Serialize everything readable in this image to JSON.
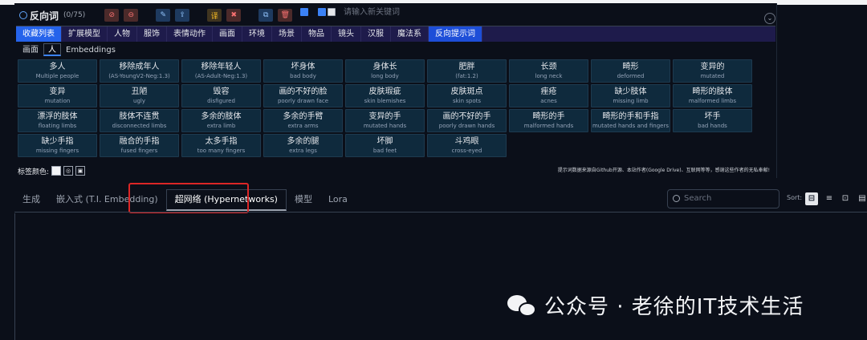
{
  "negative": {
    "title": "反向词",
    "count": "(0/75)",
    "keyword_placeholder": "请输入新关键词"
  },
  "category_tabs": [
    "收藏列表",
    "扩展模型",
    "人物",
    "服饰",
    "表情动作",
    "画面",
    "环境",
    "场景",
    "物品",
    "镜头",
    "汉服",
    "魔法系",
    "反向提示词"
  ],
  "sub_tabs": [
    "画面",
    "人",
    "Embeddings"
  ],
  "tags": [
    {
      "cn": "多人",
      "en": "Multiple people"
    },
    {
      "cn": "移除成年人",
      "en": "(AS-YoungV2-Neg:1.3)"
    },
    {
      "cn": "移除年轻人",
      "en": "(AS-Adult-Neg:1.3)"
    },
    {
      "cn": "坏身体",
      "en": "bad body"
    },
    {
      "cn": "身体长",
      "en": "long body"
    },
    {
      "cn": "肥胖",
      "en": "(fat:1.2)"
    },
    {
      "cn": "长颈",
      "en": "long neck"
    },
    {
      "cn": "畸形",
      "en": "deformed"
    },
    {
      "cn": "变异的",
      "en": "mutated"
    },
    {
      "cn": "变异",
      "en": "mutation"
    },
    {
      "cn": "丑陋",
      "en": "ugly"
    },
    {
      "cn": "毁容",
      "en": "disfigured"
    },
    {
      "cn": "画的不好的脸",
      "en": "poorly drawn face"
    },
    {
      "cn": "皮肤瑕疵",
      "en": "skin blemishes"
    },
    {
      "cn": "皮肤斑点",
      "en": "skin spots"
    },
    {
      "cn": "痤疮",
      "en": "acnes"
    },
    {
      "cn": "缺少肢体",
      "en": "missing limb"
    },
    {
      "cn": "畸形的肢体",
      "en": "malformed limbs"
    },
    {
      "cn": "漂浮的肢体",
      "en": "floating limbs"
    },
    {
      "cn": "肢体不连贯",
      "en": "disconnected limbs"
    },
    {
      "cn": "多余的肢体",
      "en": "extra limb"
    },
    {
      "cn": "多余的手臂",
      "en": "extra arms"
    },
    {
      "cn": "变异的手",
      "en": "mutated hands"
    },
    {
      "cn": "画的不好的手",
      "en": "poorly drawn hands"
    },
    {
      "cn": "畸形的手",
      "en": "malformed hands"
    },
    {
      "cn": "畸形的手和手指",
      "en": "mutated hands and fingers"
    },
    {
      "cn": "坏手",
      "en": "bad hands"
    },
    {
      "cn": "缺少手指",
      "en": "missing fingers"
    },
    {
      "cn": "融合的手指",
      "en": "fused fingers"
    },
    {
      "cn": "太多手指",
      "en": "too many fingers"
    },
    {
      "cn": "多余的腿",
      "en": "extra legs"
    },
    {
      "cn": "坏脚",
      "en": "bad feet"
    },
    {
      "cn": "斗鸡眼",
      "en": "cross-eyed"
    }
  ],
  "color_label": "标签颜色:",
  "footnote": "提示词数据来源自Github开源、本站作者(Google Drive)、互联网等等，感谢这些作者的无私奉献!",
  "main_tabs": [
    "生成",
    "嵌入式 (T.I. Embedding)",
    "超网络 (Hypernetworks)",
    "模型",
    "Lora"
  ],
  "search_placeholder": "Search",
  "sort_label": "Sort:",
  "watermark": "公众号 · 老徐的IT技术生活"
}
